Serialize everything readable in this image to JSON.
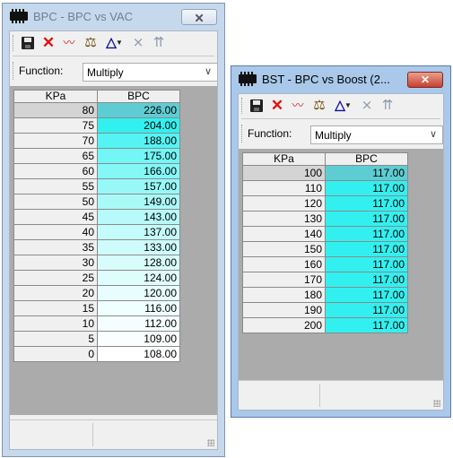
{
  "windows": [
    {
      "id": "bpc",
      "title": "BPC - BPC vs VAC",
      "close_label": "🗙",
      "function_label": "Function:",
      "function_value": "Multiply",
      "function_extra": "V",
      "table": {
        "headers": [
          "KPa",
          "BPC"
        ],
        "rows": [
          {
            "kpa": "80",
            "bpc": "226.00",
            "color": "#5ecdd3"
          },
          {
            "kpa": "75",
            "bpc": "204.00",
            "color": "#33f0f0"
          },
          {
            "kpa": "70",
            "bpc": "188.00",
            "color": "#55f4f4"
          },
          {
            "kpa": "65",
            "bpc": "175.00",
            "color": "#72f6f6"
          },
          {
            "kpa": "60",
            "bpc": "166.00",
            "color": "#84f7f7"
          },
          {
            "kpa": "55",
            "bpc": "157.00",
            "color": "#98f8f8"
          },
          {
            "kpa": "50",
            "bpc": "149.00",
            "color": "#aaf9f9"
          },
          {
            "kpa": "45",
            "bpc": "143.00",
            "color": "#b8fafa"
          },
          {
            "kpa": "40",
            "bpc": "137.00",
            "color": "#c4fbfb"
          },
          {
            "kpa": "35",
            "bpc": "133.00",
            "color": "#cefcfc"
          },
          {
            "kpa": "30",
            "bpc": "128.00",
            "color": "#d8fcfc"
          },
          {
            "kpa": "25",
            "bpc": "124.00",
            "color": "#e0fdfd"
          },
          {
            "kpa": "20",
            "bpc": "120.00",
            "color": "#e8fdfd"
          },
          {
            "kpa": "15",
            "bpc": "116.00",
            "color": "#effefe"
          },
          {
            "kpa": "10",
            "bpc": "112.00",
            "color": "#f5fefe"
          },
          {
            "kpa": "5",
            "bpc": "109.00",
            "color": "#fafefe"
          },
          {
            "kpa": "0",
            "bpc": "108.00",
            "color": "#ffffff"
          }
        ]
      }
    },
    {
      "id": "bst",
      "title": "BST - BPC vs Boost (2...",
      "close_label": "✕",
      "function_label": "Function:",
      "function_value": "Multiply",
      "function_extra": "V",
      "table": {
        "headers": [
          "KPa",
          "BPC"
        ],
        "rows": [
          {
            "kpa": "100",
            "bpc": "117.00",
            "color": "#5ecdd3"
          },
          {
            "kpa": "110",
            "bpc": "117.00",
            "color": "#33f0f0"
          },
          {
            "kpa": "120",
            "bpc": "117.00",
            "color": "#33f0f0"
          },
          {
            "kpa": "130",
            "bpc": "117.00",
            "color": "#33f0f0"
          },
          {
            "kpa": "140",
            "bpc": "117.00",
            "color": "#33f0f0"
          },
          {
            "kpa": "150",
            "bpc": "117.00",
            "color": "#33f0f0"
          },
          {
            "kpa": "160",
            "bpc": "117.00",
            "color": "#33f0f0"
          },
          {
            "kpa": "170",
            "bpc": "117.00",
            "color": "#33f0f0"
          },
          {
            "kpa": "180",
            "bpc": "117.00",
            "color": "#33f0f0"
          },
          {
            "kpa": "190",
            "bpc": "117.00",
            "color": "#33f0f0"
          },
          {
            "kpa": "200",
            "bpc": "117.00",
            "color": "#33f0f0"
          }
        ]
      }
    }
  ],
  "toolbar_icons": [
    "save-icon",
    "delete-icon",
    "chart-icon",
    "balance-icon",
    "triangle-tool-icon",
    "dropdown-arrow-icon",
    "clear-icon",
    "interpolate-icon"
  ]
}
